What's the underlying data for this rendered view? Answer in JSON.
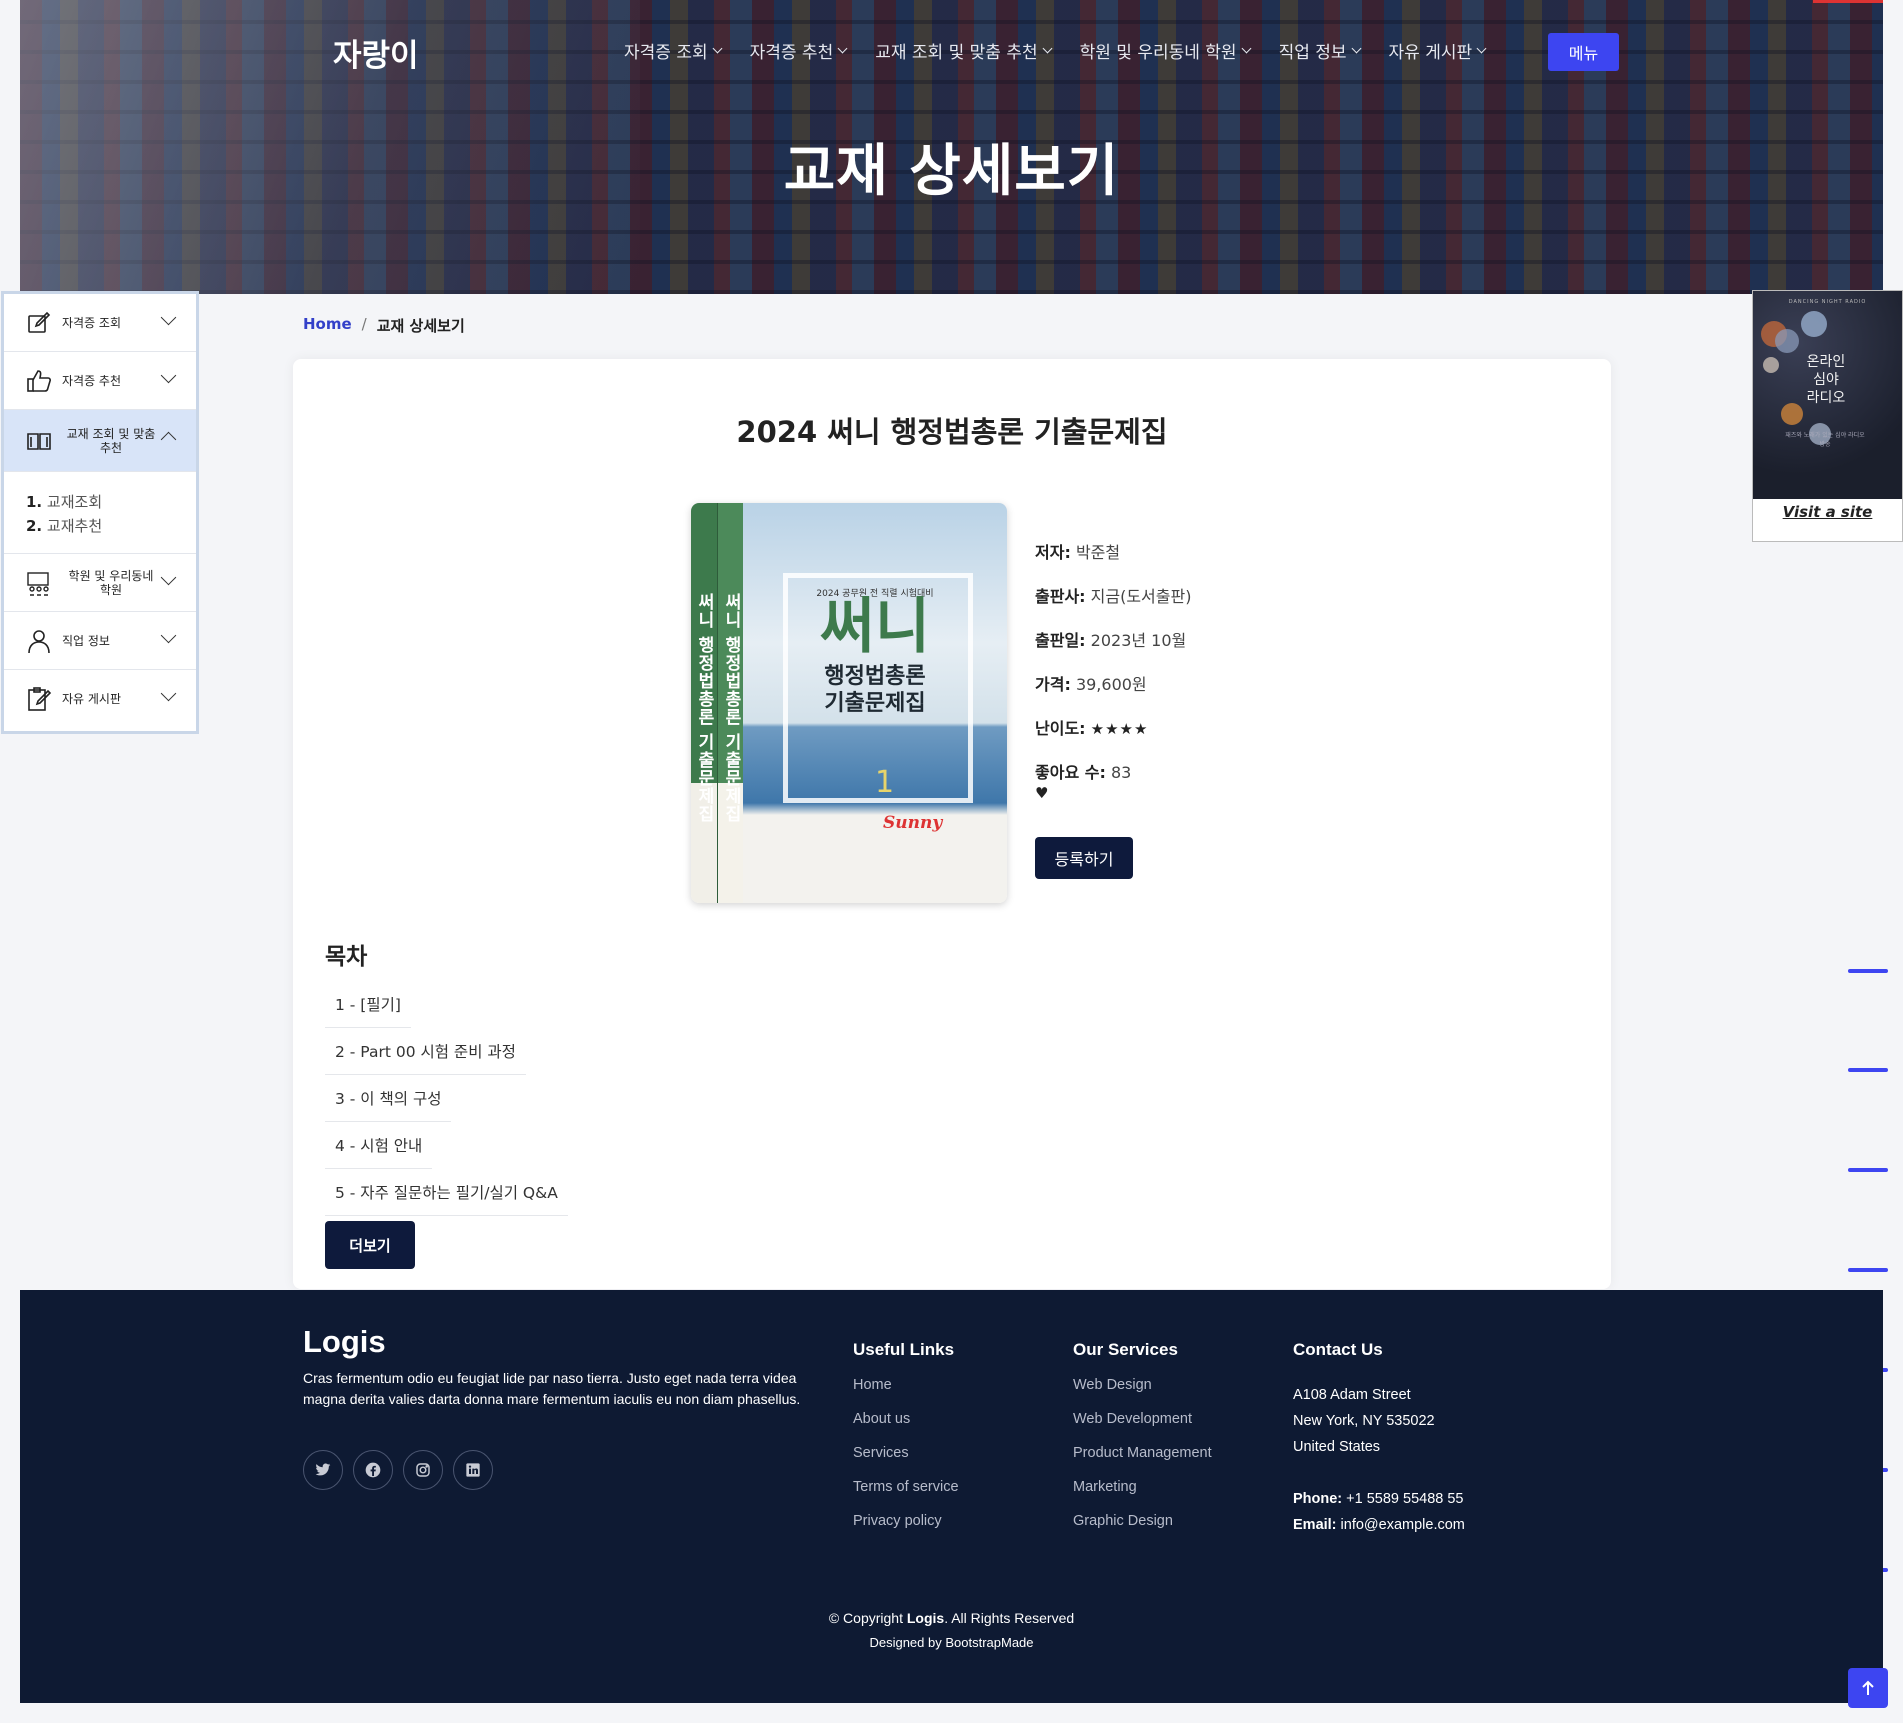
{
  "header": {
    "logo": "자랑이",
    "nav": [
      "자격증 조회",
      "자격증 추천",
      "교재 조회 및 맞춤 추천",
      "학원 및 우리동네 학원",
      "직업 정보",
      "자유 게시판"
    ],
    "menu_button": "메뉴",
    "page_title": "교재 상세보기"
  },
  "sidebar": {
    "items": [
      {
        "label": "자격증 조회",
        "icon": "edit-icon"
      },
      {
        "label": "자격증 추천",
        "icon": "thumbs-up-icon"
      },
      {
        "label": "교재 조회 및 맞춤 추천",
        "icon": "book-open-icon"
      },
      {
        "label": "학원 및 우리동네 학원",
        "icon": "classroom-icon"
      },
      {
        "label": "직업 정보",
        "icon": "person-icon"
      },
      {
        "label": "자유 게시판",
        "icon": "clipboard-edit-icon"
      }
    ],
    "submenu": [
      {
        "num": "1.",
        "label": "교재조회"
      },
      {
        "num": "2.",
        "label": "교재추천"
      }
    ]
  },
  "ad": {
    "top_text": "DANCING NIGHT RADIO",
    "text_line1": "온라인",
    "text_line2": "심야",
    "text_line3": "라디오",
    "small_text": "재즈와 노래가 있는 심야 라디오 방송",
    "link": "Visit a site"
  },
  "breadcrumb": {
    "home": "Home",
    "separator": "/",
    "current": "교재 상세보기"
  },
  "book": {
    "title": "2024 써니 행정법총론 기출문제집",
    "cover": {
      "spine_text": "써니 행정법총론 기출문제집",
      "year_line": "2024 공무원 전 직렬 시험대비",
      "main": "써니",
      "sub1": "행정법총론",
      "sub2": "기출문제집",
      "brand": "Sunny",
      "volume": "1"
    },
    "author_label": "저자:",
    "author": "박준철",
    "publisher_label": "출판사:",
    "publisher": "지금(도서출판)",
    "date_label": "출판일:",
    "date": "2023년 10월",
    "price_label": "가격:",
    "price": "39,600원",
    "difficulty_label": "난이도:",
    "difficulty_stars": "★★★★",
    "difficulty_value": 4,
    "likes_label": "좋아요 수:",
    "likes": "83",
    "heart": "♥",
    "register_button": "등록하기"
  },
  "toc": {
    "title": "목차",
    "items": [
      "1 - [필기]",
      "2 - Part 00 시험 준비 과정",
      "3 - 이 책의 구성",
      "4 - 시험 안내",
      "5 - 자주 질문하는 필기/실기 Q&A"
    ],
    "more_button": "더보기"
  },
  "footer": {
    "brand": "Logis",
    "description": "Cras fermentum odio eu feugiat lide par naso tierra. Justo eget nada terra videa magna derita valies darta donna mare fermentum iaculis eu non diam phasellus.",
    "socials": [
      "twitter-icon",
      "facebook-icon",
      "instagram-icon",
      "linkedin-icon"
    ],
    "useful_links": {
      "title": "Useful Links",
      "items": [
        "Home",
        "About us",
        "Services",
        "Terms of service",
        "Privacy policy"
      ]
    },
    "our_services": {
      "title": "Our Services",
      "items": [
        "Web Design",
        "Web Development",
        "Product Management",
        "Marketing",
        "Graphic Design"
      ]
    },
    "contact": {
      "title": "Contact Us",
      "address1": "A108 Adam Street",
      "address2": "New York, NY 535022",
      "address3": "United States",
      "phone_label": "Phone:",
      "phone": "+1 5589 55488 55",
      "email_label": "Email:",
      "email": "info@example.com"
    },
    "copyright_prefix": "© Copyright ",
    "copyright_brand": "Logis",
    "copyright_suffix": ". All Rights Reserved",
    "credits": "Designed by BootstrapMade"
  },
  "colors": {
    "accent": "#3d45f1",
    "navy": "#0e1a33",
    "button_dark": "#0e1a3c",
    "sidebar_active": "#d8e4f8"
  }
}
